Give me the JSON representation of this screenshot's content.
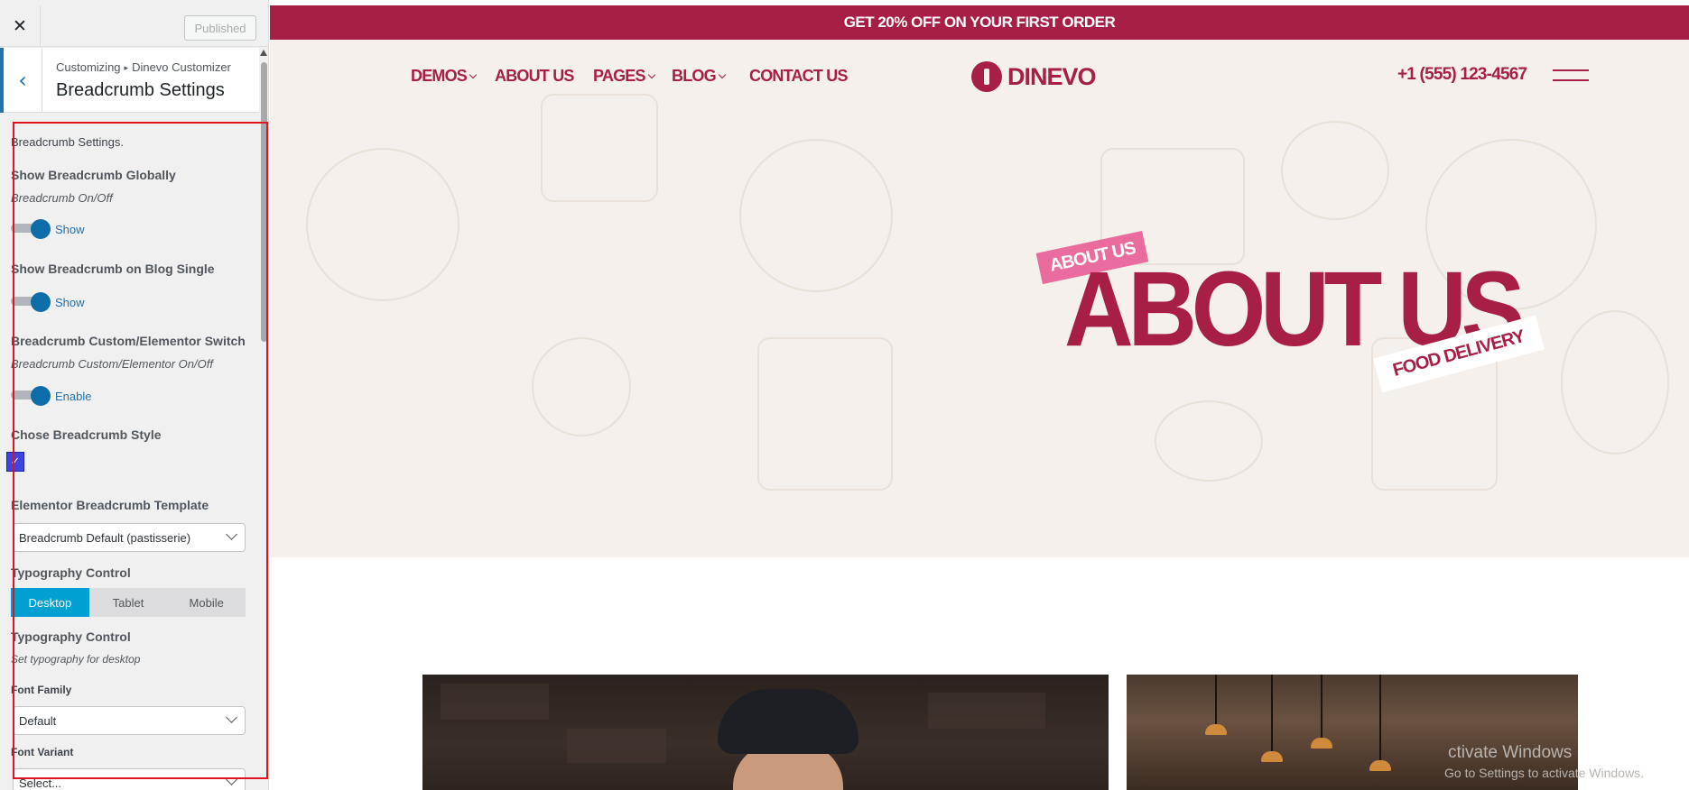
{
  "sidebar": {
    "close_icon": "close-icon",
    "published_label": "Published",
    "breadcrumb": {
      "parent": "Customizing",
      "arrow": "▸",
      "current": "Dinevo Customizer"
    },
    "section_title": "Breadcrumb Settings",
    "intro_text": "Breadcrumb Settings.",
    "show_globally": {
      "label": "Show Breadcrumb Globally",
      "description": "Breadcrumb On/Off",
      "state_text": "Show",
      "on": true
    },
    "show_blog_single": {
      "label": "Show Breadcrumb on Blog Single",
      "state_text": "Show",
      "on": true
    },
    "custom_switch": {
      "label": "Breadcrumb Custom/Elementor Switch",
      "description": "Breadcrumb Custom/Elementor On/Off",
      "state_text": "Enable",
      "on": true
    },
    "style": {
      "label": "Chose Breadcrumb Style",
      "checked_glyph": "✓"
    },
    "template": {
      "label": "Elementor Breadcrumb Template",
      "value": "Breadcrumb Default (pastisserie)"
    },
    "typography_tabs": {
      "label": "Typography Control",
      "tabs": [
        "Desktop",
        "Tablet",
        "Mobile"
      ],
      "active": "Desktop"
    },
    "typography": {
      "label": "Typography Control",
      "description": "Set typography for desktop"
    },
    "font_family": {
      "label": "Font Family",
      "value": "Default"
    },
    "font_variant": {
      "label": "Font Variant",
      "value": "Select..."
    },
    "accent_color": "#2271b1",
    "highlight_color": "#e0141e"
  },
  "preview": {
    "promo_text": "GET 20% OFF ON YOUR FIRST ORDER",
    "nav": [
      {
        "label": "DEMOS",
        "dropdown": true
      },
      {
        "label": "ABOUT US",
        "dropdown": false
      },
      {
        "label": "PAGES",
        "dropdown": true
      },
      {
        "label": "BLOG",
        "dropdown": true
      },
      {
        "label": "CONTACT US",
        "dropdown": false
      }
    ],
    "logo_text": "DINEVO",
    "phone": "+1 (555) 123-4567",
    "hero": {
      "tag": "ABOUT US",
      "title": "ABOUT US",
      "subtitle": "FOOD DELIVERY"
    },
    "brand_color": "#a71f44",
    "watermark": {
      "line1": "ctivate Windows",
      "line2": "Go to Settings to activate Windows."
    }
  }
}
